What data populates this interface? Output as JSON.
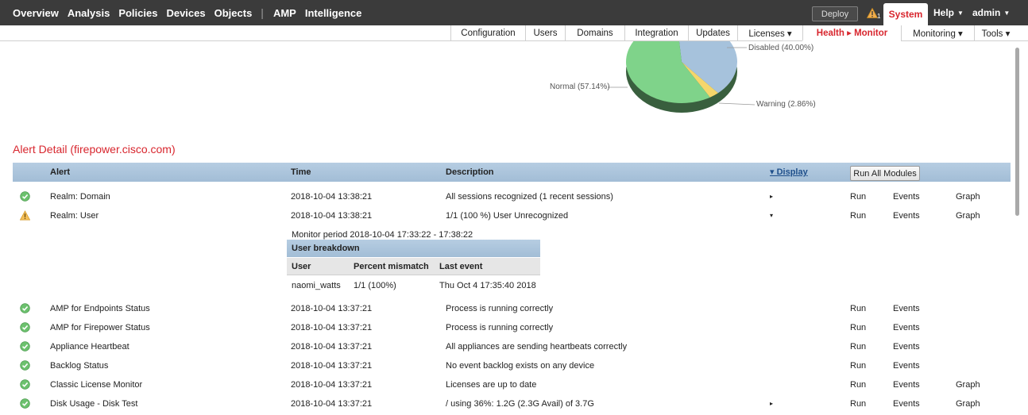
{
  "topnav": {
    "items": [
      "Overview",
      "Analysis",
      "Policies",
      "Devices",
      "Objects",
      "AMP",
      "Intelligence"
    ],
    "deploy_label": "Deploy",
    "warning_count": "1",
    "system_label": "System",
    "help_label": "Help",
    "admin_label": "admin"
  },
  "subnav": {
    "items": [
      "Configuration",
      "Users",
      "Domains",
      "Integration",
      "Updates",
      "Licenses ▾",
      "Health ▸ Monitor",
      "Monitoring ▾",
      "Tools ▾"
    ],
    "active_index": 6
  },
  "chart_data": {
    "type": "pie",
    "slices": [
      {
        "label": "Normal (57.14%)",
        "value": 57.14,
        "color": "#7fd38a"
      },
      {
        "label": "Warning (2.86%)",
        "value": 2.86,
        "color": "#f5d66b"
      },
      {
        "label": "Disabled (40.00%)",
        "value": 40.0,
        "color": "#a6c2dc"
      }
    ]
  },
  "alert_detail": {
    "title": "Alert Detail (firepower.cisco.com)",
    "headers": {
      "alert": "Alert",
      "time": "Time",
      "description": "Description",
      "display": "▾ Display",
      "run_all": "Run All Modules"
    },
    "rows": [
      {
        "status": "ok",
        "alert": "Realm: Domain",
        "time": "2018-10-04 13:38:21",
        "description": "All sessions recognized (1 recent sessions)",
        "expand": "▸",
        "run": "Run",
        "events": "Events",
        "graph": "Graph"
      },
      {
        "status": "warning",
        "alert": "Realm: User",
        "time": "2018-10-04 13:38:21",
        "description": "1/1 (100 %) User Unrecognized",
        "expand": "▾",
        "run": "Run",
        "events": "Events",
        "graph": "Graph"
      },
      {
        "status": "ok",
        "alert": "AMP for Endpoints Status",
        "time": "2018-10-04 13:37:21",
        "description": "Process is running correctly",
        "expand": "",
        "run": "Run",
        "events": "Events",
        "graph": ""
      },
      {
        "status": "ok",
        "alert": "AMP for Firepower Status",
        "time": "2018-10-04 13:37:21",
        "description": "Process is running correctly",
        "expand": "",
        "run": "Run",
        "events": "Events",
        "graph": ""
      },
      {
        "status": "ok",
        "alert": "Appliance Heartbeat",
        "time": "2018-10-04 13:37:21",
        "description": "All appliances are sending heartbeats correctly",
        "expand": "",
        "run": "Run",
        "events": "Events",
        "graph": ""
      },
      {
        "status": "ok",
        "alert": "Backlog Status",
        "time": "2018-10-04 13:37:21",
        "description": "No event backlog exists on any device",
        "expand": "",
        "run": "Run",
        "events": "Events",
        "graph": ""
      },
      {
        "status": "ok",
        "alert": "Classic License Monitor",
        "time": "2018-10-04 13:37:21",
        "description": "Licenses are up to date",
        "expand": "",
        "run": "Run",
        "events": "Events",
        "graph": "Graph"
      },
      {
        "status": "ok",
        "alert": "Disk Usage - Disk Test",
        "time": "2018-10-04 13:37:21",
        "description": "/ using 36%: 1.2G (2.3G Avail) of 3.7G",
        "expand": "▸",
        "run": "Run",
        "events": "Events",
        "graph": "Graph"
      }
    ],
    "breakdown": {
      "monitor_period": "Monitor period 2018-10-04 17:33:22 - 17:38:22",
      "title": "User breakdown",
      "columns": [
        "User",
        "Percent mismatch",
        "Last event"
      ],
      "rows": [
        [
          "naomi_watts",
          "1/1 (100%)",
          "Thu Oct 4 17:35:40 2018"
        ]
      ]
    }
  },
  "colors": {
    "accent_red": "#d8262e",
    "ok_green": "#5cb85c",
    "warning_yellow": "#f0ad4e",
    "header_blue": "#a9c3db"
  }
}
